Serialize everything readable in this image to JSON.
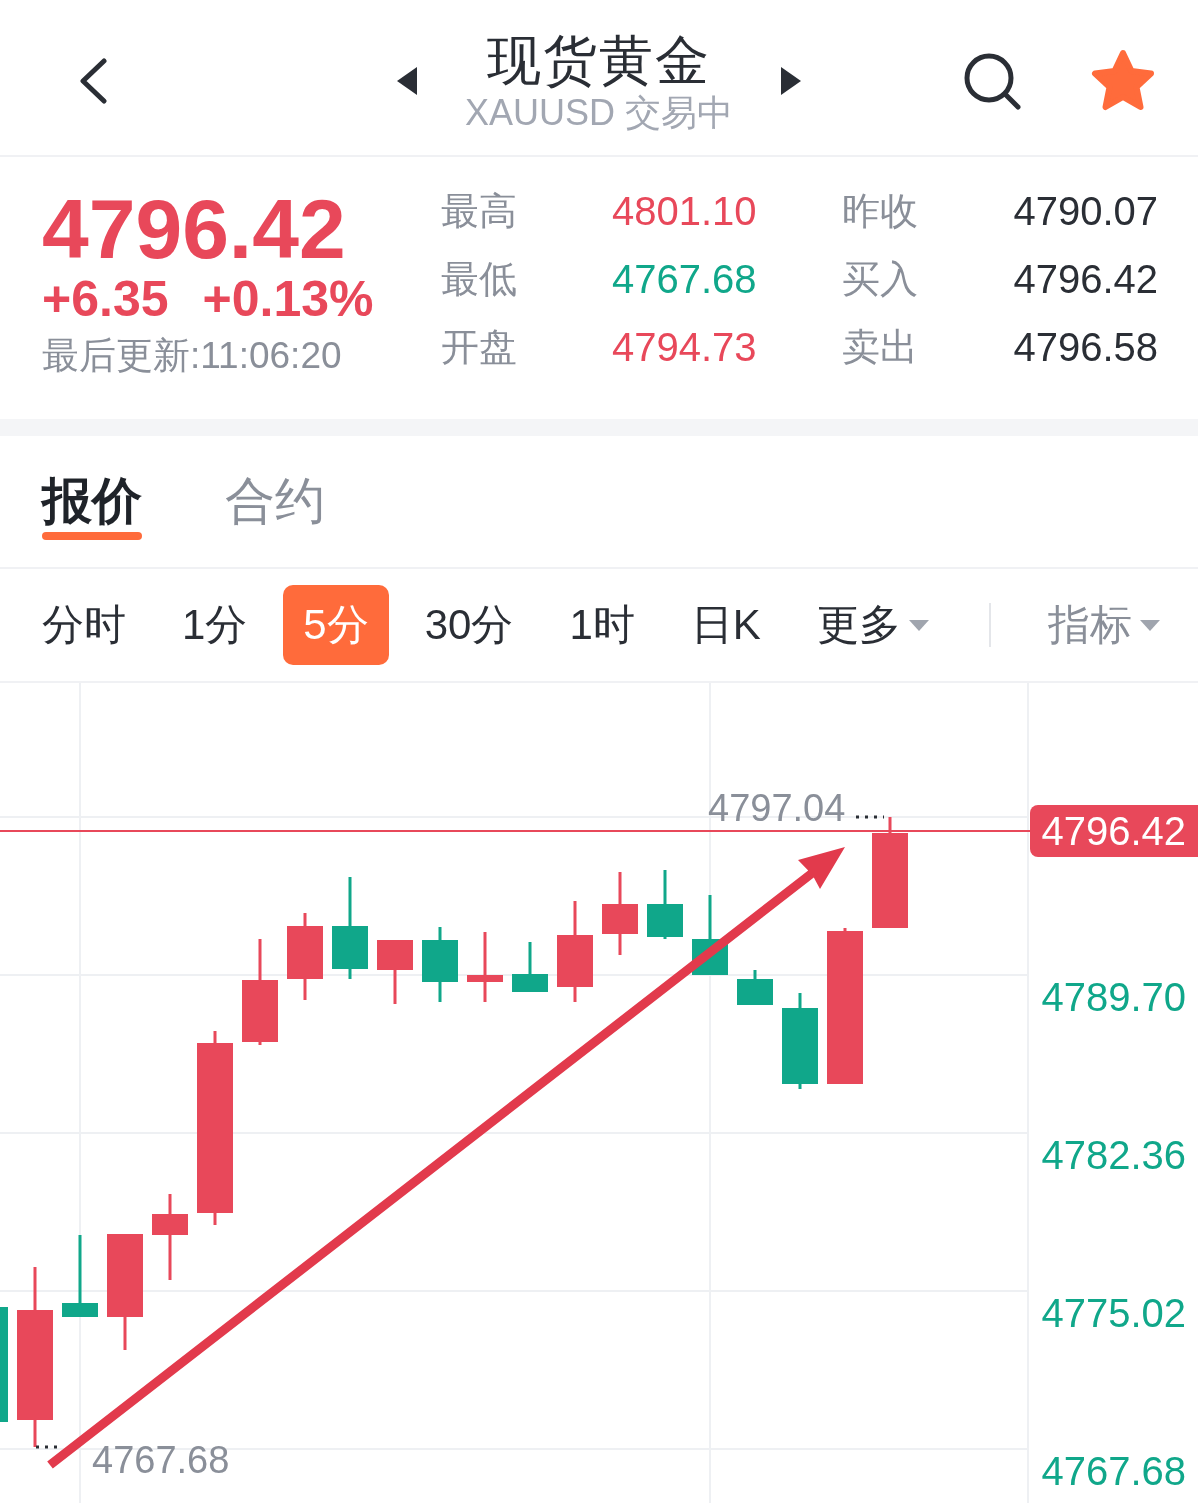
{
  "header": {
    "title": "现货黄金",
    "subtitle": "XAUUSD 交易中",
    "favorite": true
  },
  "quote": {
    "price": "4796.42",
    "change": "+6.35",
    "change_percent": "+0.13%",
    "updated": "最后更新:11:06:20"
  },
  "stats": [
    {
      "label": "最高",
      "value": "4801.10",
      "color": "#e8485a"
    },
    {
      "label": "昨收",
      "value": "4790.07",
      "color": "#2a2e35"
    },
    {
      "label": "最低",
      "value": "4767.68",
      "color": "#10a78a"
    },
    {
      "label": "买入",
      "value": "4796.42",
      "color": "#2a2e35"
    },
    {
      "label": "开盘",
      "value": "4794.73",
      "color": "#e8485a"
    },
    {
      "label": "卖出",
      "value": "4796.58",
      "color": "#2a2e35"
    }
  ],
  "tabs": [
    {
      "label": "报价",
      "selected": true
    },
    {
      "label": "合约",
      "selected": false
    }
  ],
  "periods": [
    {
      "label": "分时",
      "selected": false,
      "kind": "period"
    },
    {
      "label": "1分",
      "selected": false,
      "kind": "period"
    },
    {
      "label": "5分",
      "selected": true,
      "kind": "period"
    },
    {
      "label": "30分",
      "selected": false,
      "kind": "period"
    },
    {
      "label": "1时",
      "selected": false,
      "kind": "period"
    },
    {
      "label": "日K",
      "selected": false,
      "kind": "period"
    },
    {
      "label": "更多",
      "selected": false,
      "kind": "menu"
    }
  ],
  "indicator_menu": {
    "label": "指标"
  },
  "chart": {
    "price_axis": [
      "4789.70",
      "4782.36",
      "4775.02",
      "4767.68"
    ],
    "current_price": "4796.42",
    "high_label": "4797.04",
    "low_label": "4767.68"
  }
}
